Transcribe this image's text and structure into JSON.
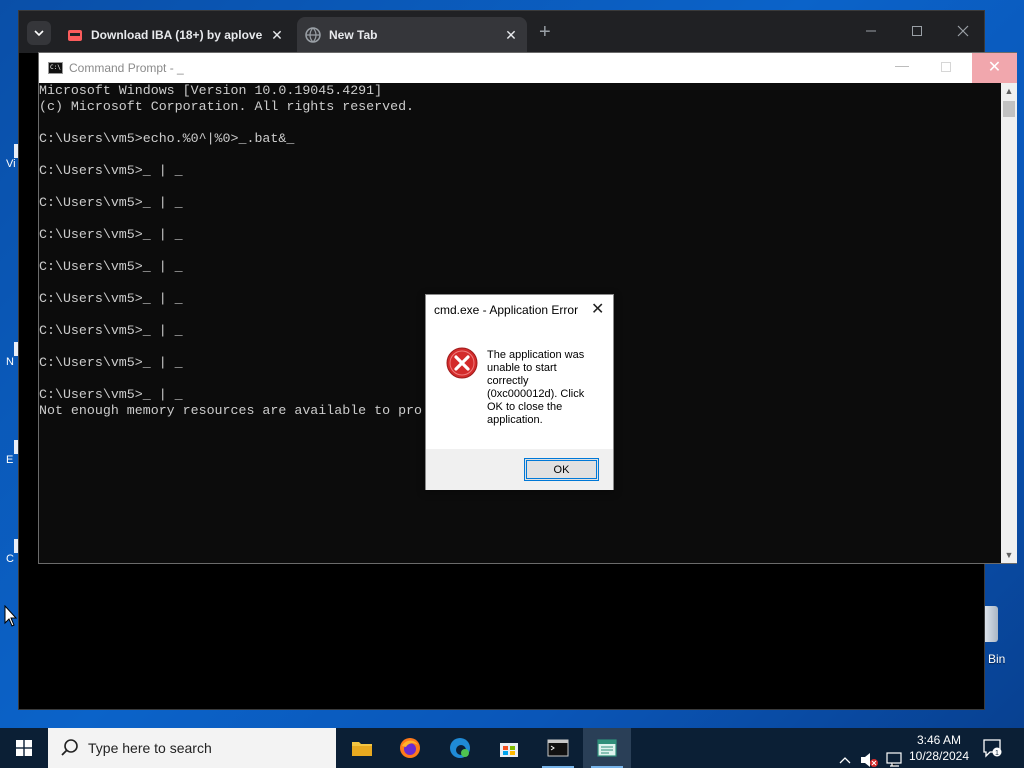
{
  "desktop": {
    "partial_labels": [
      "Vi",
      "N",
      "E",
      "C"
    ],
    "recycle_bin_label": "Bin"
  },
  "browser": {
    "tabs": [
      {
        "title": "Download IBA (18+) by aplove",
        "active": false,
        "favicon": "red-game-icon"
      },
      {
        "title": "New Tab",
        "active": true,
        "favicon": "globe-icon"
      }
    ],
    "new_tab_symbol": "+",
    "close_symbol": "✕"
  },
  "cmd": {
    "title": "Command Prompt - _",
    "lines": [
      "Microsoft Windows [Version 10.0.19045.4291]",
      "(c) Microsoft Corporation. All rights reserved.",
      "",
      "C:\\Users\\vm5>echo.%0^|%0>_.bat&_",
      "",
      "C:\\Users\\vm5>_ | _",
      "",
      "C:\\Users\\vm5>_ | _",
      "",
      "C:\\Users\\vm5>_ | _",
      "",
      "C:\\Users\\vm5>_ | _",
      "",
      "C:\\Users\\vm5>_ | _",
      "",
      "C:\\Users\\vm5>_ | _",
      "",
      "C:\\Users\\vm5>_ | _",
      "",
      "C:\\Users\\vm5>_ | _",
      "Not enough memory resources are available to pro"
    ]
  },
  "dialog": {
    "title": "cmd.exe - Application Error",
    "message": "The application was unable to start correctly (0xc000012d). Click OK to close the application.",
    "ok_label": "OK",
    "icon": "error-icon"
  },
  "taskbar": {
    "search_placeholder": "Type here to search",
    "apps": [
      "file-explorer-icon",
      "firefox-icon",
      "edge-icon",
      "store-icon",
      "command-prompt-icon",
      "notepad-icon"
    ],
    "clock_time": "3:46 AM",
    "clock_date": "10/28/2024"
  },
  "colors": {
    "desktop": "#0b63c9",
    "console_text": "#cccccc",
    "taskbar": "#0b1f35",
    "error_red": "#d32b2b",
    "focus_blue": "#0078d7"
  }
}
